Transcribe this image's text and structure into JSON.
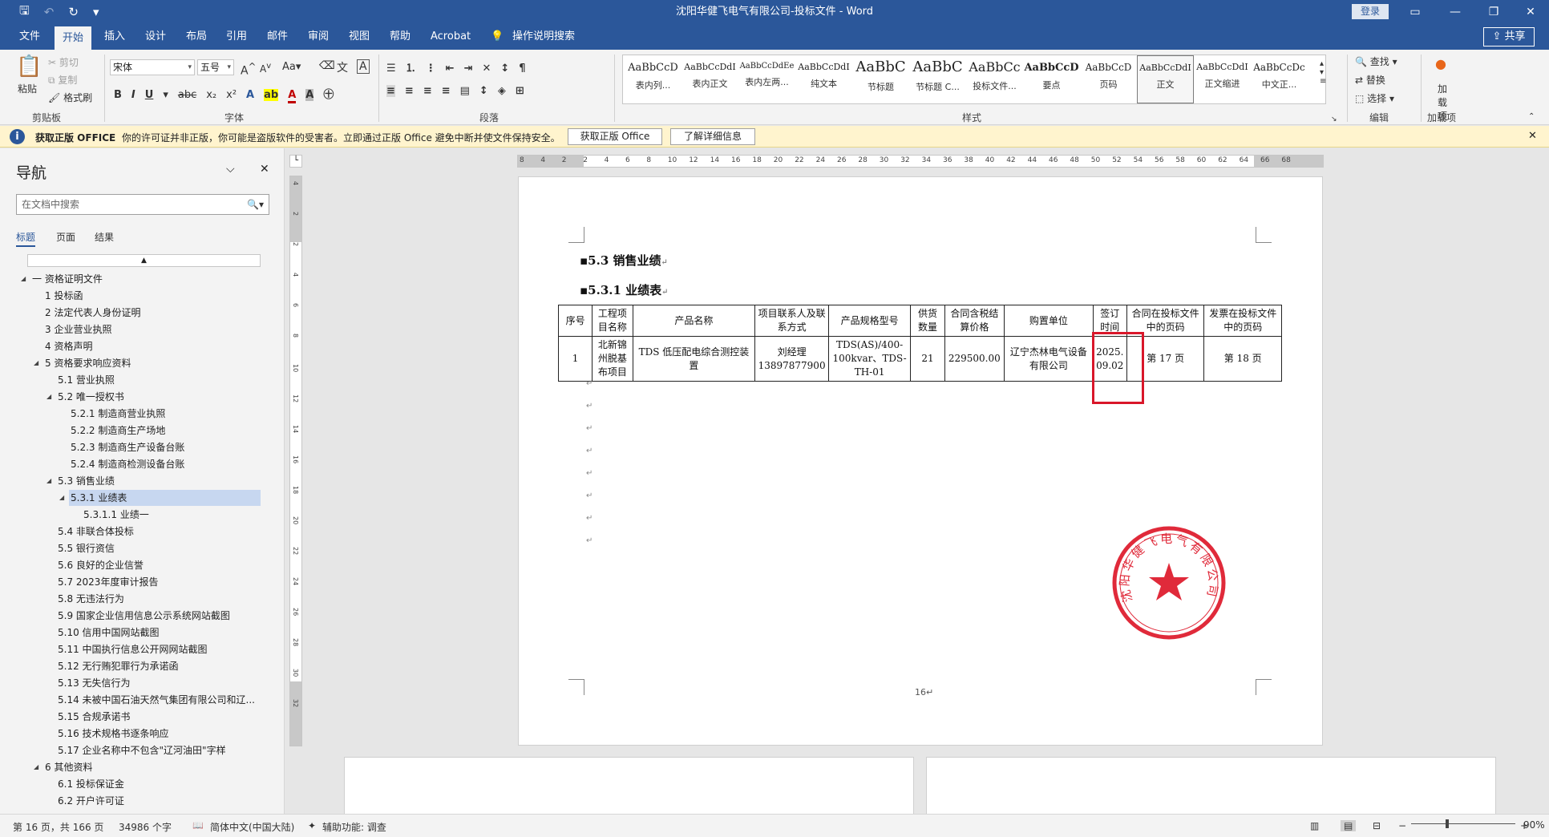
{
  "window": {
    "title": "沈阳华健飞电气有限公司-投标文件  -  Word",
    "login": "登录",
    "share": "共享",
    "qa_icons": [
      "save-icon",
      "undo-icon",
      "redo-icon",
      "customize-icon"
    ]
  },
  "ribbon": {
    "tabs": [
      "文件",
      "开始",
      "插入",
      "设计",
      "布局",
      "引用",
      "邮件",
      "审阅",
      "视图",
      "帮助",
      "Acrobat",
      "操作说明搜索"
    ],
    "active_tab": "开始",
    "clipboard": {
      "paste": "粘贴",
      "cut": "剪切",
      "copy": "复制",
      "format_painter": "格式刷",
      "label": "剪贴板"
    },
    "font": {
      "name": "宋体",
      "size": "五号",
      "label": "字体",
      "case": "Aa",
      "grow": "A",
      "shrink": "A"
    },
    "paragraph_label": "段落",
    "styles": {
      "label": "样式",
      "items": [
        {
          "sample": "AaBbCcD",
          "name": "表内列..."
        },
        {
          "sample": "AaBbCcDdI",
          "name": "表内正文"
        },
        {
          "sample": "AaBbCcDdEe",
          "name": "表内左两..."
        },
        {
          "sample": "AaBbCcDdI",
          "name": "纯文本"
        },
        {
          "sample": "AaBbC",
          "name": "节标题"
        },
        {
          "sample": "AaBbC",
          "name": "节标题 C..."
        },
        {
          "sample": "AaBbCc",
          "name": "投标文件..."
        },
        {
          "sample": "AaBbCcD",
          "name": "要点"
        },
        {
          "sample": "AaBbCcD",
          "name": "页码"
        },
        {
          "sample": "AaBbCcDdI",
          "name": "正文"
        },
        {
          "sample": "AaBbCcDdI",
          "name": "正文缩进"
        },
        {
          "sample": "AaBbCcDc",
          "name": "中文正..."
        }
      ]
    },
    "editing": {
      "find": "查找",
      "replace": "替换",
      "select": "选择",
      "label": "编辑"
    },
    "addins": {
      "button": "加\n载项",
      "label": "加载项"
    }
  },
  "infobar": {
    "title": "获取正版 OFFICE",
    "message": "你的许可证并非正版，你可能是盗版软件的受害者。立即通过正版 Office 避免中断并使文件保持安全。",
    "btn_get": "获取正版 Office",
    "btn_more": "了解详细信息"
  },
  "nav": {
    "title": "导航",
    "search_placeholder": "在文档中搜索",
    "tabs": [
      "标题",
      "页面",
      "结果"
    ],
    "items": [
      {
        "text": "一 资格证明文件",
        "level": 0,
        "tri": "open"
      },
      {
        "text": "1 投标函",
        "level": 1
      },
      {
        "text": "2 法定代表人身份证明",
        "level": 1
      },
      {
        "text": "3 企业营业执照",
        "level": 1
      },
      {
        "text": "4 资格声明",
        "level": 1
      },
      {
        "text": "5 资格要求响应资料",
        "level": 1,
        "tri": "open"
      },
      {
        "text": "5.1 营业执照",
        "level": 2
      },
      {
        "text": "5.2 唯一授权书",
        "level": 2,
        "tri": "open"
      },
      {
        "text": "5.2.1 制造商营业执照",
        "level": 3
      },
      {
        "text": "5.2.2 制造商生产场地",
        "level": 3
      },
      {
        "text": "5.2.3 制造商生产设备台账",
        "level": 3
      },
      {
        "text": "5.2.4 制造商检测设备台账",
        "level": 3
      },
      {
        "text": "5.3 销售业绩",
        "level": 2,
        "tri": "open"
      },
      {
        "text": "5.3.1 业绩表",
        "level": 3,
        "tri": "open",
        "selected": true
      },
      {
        "text": "5.3.1.1 业绩一",
        "level": 4
      },
      {
        "text": "5.4 非联合体投标",
        "level": 2
      },
      {
        "text": "5.5 银行资信",
        "level": 2
      },
      {
        "text": "5.6 良好的企业信誉",
        "level": 2
      },
      {
        "text": "5.7 2023年度审计报告",
        "level": 2
      },
      {
        "text": "5.8 无违法行为",
        "level": 2
      },
      {
        "text": "5.9 国家企业信用信息公示系统网站截图",
        "level": 2
      },
      {
        "text": "5.10 信用中国网站截图",
        "level": 2
      },
      {
        "text": "5.11 中国执行信息公开网网站截图",
        "level": 2
      },
      {
        "text": "5.12 无行贿犯罪行为承诺函",
        "level": 2
      },
      {
        "text": "5.13 无失信行为",
        "level": 2
      },
      {
        "text": "5.14 未被中国石油天然气集团有限公司和辽...",
        "level": 2
      },
      {
        "text": "5.15 合规承诺书",
        "level": 2
      },
      {
        "text": "5.16 技术规格书逐条响应",
        "level": 2
      },
      {
        "text": "5.17 企业名称中不包含\"辽河油田\"字样",
        "level": 2
      },
      {
        "text": "6 其他资料",
        "level": 1,
        "tri": "open"
      },
      {
        "text": "6.1 投标保证金",
        "level": 2
      },
      {
        "text": "6.2 开户许可证",
        "level": 2
      }
    ]
  },
  "ruler": {
    "h_ticks": [
      "8",
      "4",
      "2",
      "2",
      "4",
      "6",
      "8",
      "10",
      "12",
      "14",
      "16",
      "18",
      "20",
      "22",
      "24",
      "26",
      "28",
      "30",
      "32",
      "34",
      "36",
      "38",
      "40",
      "42",
      "44",
      "46",
      "48",
      "50",
      "52",
      "54",
      "56",
      "58",
      "60",
      "62",
      "64",
      "66",
      "68"
    ],
    "v_ticks": [
      "4",
      "2",
      "2",
      "4",
      "6",
      "8",
      "10",
      "12",
      "14",
      "16",
      "18",
      "20",
      "22",
      "24",
      "26",
      "28",
      "30",
      "32"
    ]
  },
  "document": {
    "heading1": "5.3    销售业绩",
    "heading2": "5.3.1  业绩表",
    "table": {
      "headers": [
        "序号",
        "工程项目名称",
        "产品名称",
        "项目联系人及联系方式",
        "产品规格型号",
        "供货数量",
        "合同含税结算价格",
        "购置单位",
        "签订时间",
        "合同在投标文件中的页码",
        "发票在投标文件中的页码"
      ],
      "rows": [
        [
          "1",
          "北新锦州脱基布项目",
          "TDS 低压配电综合测控装置",
          "刘经理 13897877900",
          "TDS(AS)/400-100kvar、TDS-TH-01",
          "21",
          "229500.00",
          "辽宁杰林电气设备有限公司",
          "2025.09.02",
          "第 17 页",
          "第 18 页"
        ]
      ]
    },
    "seal_text": "沈阳华健飞电气有限公司",
    "page_number": "16"
  },
  "status": {
    "page": "第 16 页，共 166 页",
    "words": "34986 个字",
    "lang": "简体中文(中国大陆)",
    "accessibility": "辅助功能: 调查",
    "zoom": "90%"
  }
}
